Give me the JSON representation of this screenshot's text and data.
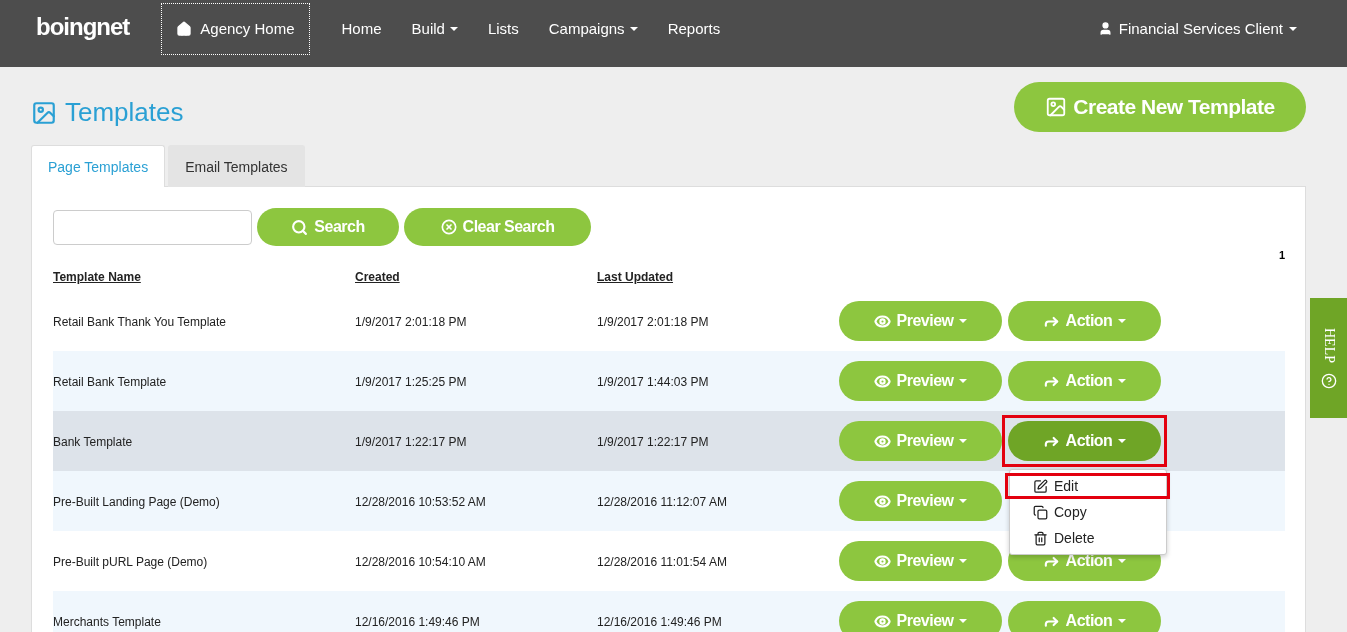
{
  "nav": {
    "logo": "boingnet",
    "agency_home": "Agency Home",
    "items": [
      {
        "label": "Home",
        "dropdown": false
      },
      {
        "label": "Build",
        "dropdown": true
      },
      {
        "label": "Lists",
        "dropdown": false
      },
      {
        "label": "Campaigns",
        "dropdown": true
      },
      {
        "label": "Reports",
        "dropdown": false
      }
    ],
    "user": "Financial Services Client"
  },
  "page_title": "Templates",
  "create_button": "Create New Template",
  "tabs": [
    {
      "label": "Page Templates",
      "selected": true
    },
    {
      "label": "Email Templates",
      "selected": false
    }
  ],
  "search_button": "Search",
  "clear_button": "Clear Search",
  "pagination": "1",
  "columns": [
    "Template Name",
    "Created",
    "Last Updated"
  ],
  "rows": [
    {
      "name": "Retail Bank Thank You Template",
      "created": "1/9/2017 2:01:18 PM",
      "updated": "1/9/2017 2:01:18 PM",
      "preview": "Preview",
      "action": "Action",
      "selected": false,
      "menu_open": false,
      "action_highlighted": false
    },
    {
      "name": "Retail Bank Template",
      "created": "1/9/2017 1:25:25 PM",
      "updated": "1/9/2017 1:44:03 PM",
      "preview": "Preview",
      "action": "Action",
      "selected": false,
      "menu_open": false,
      "action_highlighted": false
    },
    {
      "name": "Bank Template",
      "created": "1/9/2017 1:22:17 PM",
      "updated": "1/9/2017 1:22:17 PM",
      "preview": "Preview",
      "action": "Action",
      "selected": true,
      "menu_open": true,
      "action_highlighted": true
    },
    {
      "name": "Pre-Built Landing Page (Demo)",
      "created": "12/28/2016 10:53:52 AM",
      "updated": "12/28/2016 11:12:07 AM",
      "preview": "Preview",
      "selected": false
    },
    {
      "name": "Pre-Built pURL Page (Demo)",
      "created": "12/28/2016 10:54:10 AM",
      "updated": "12/28/2016 11:01:54 AM",
      "preview": "Preview",
      "action": "Action",
      "selected": false,
      "menu_open": false,
      "action_highlighted": false
    },
    {
      "name": "Merchants Template",
      "created": "12/16/2016 1:49:46 PM",
      "updated": "12/16/2016 1:49:46 PM",
      "preview": "Preview",
      "action": "Action",
      "selected": false,
      "menu_open": false,
      "action_highlighted": false
    }
  ],
  "action_menu": [
    {
      "label": "Edit",
      "kind": "edit",
      "highlighted": true
    },
    {
      "label": "Copy",
      "kind": "copy",
      "highlighted": false
    },
    {
      "label": "Delete",
      "kind": "delete",
      "highlighted": false
    }
  ],
  "help_tab": "HELP"
}
